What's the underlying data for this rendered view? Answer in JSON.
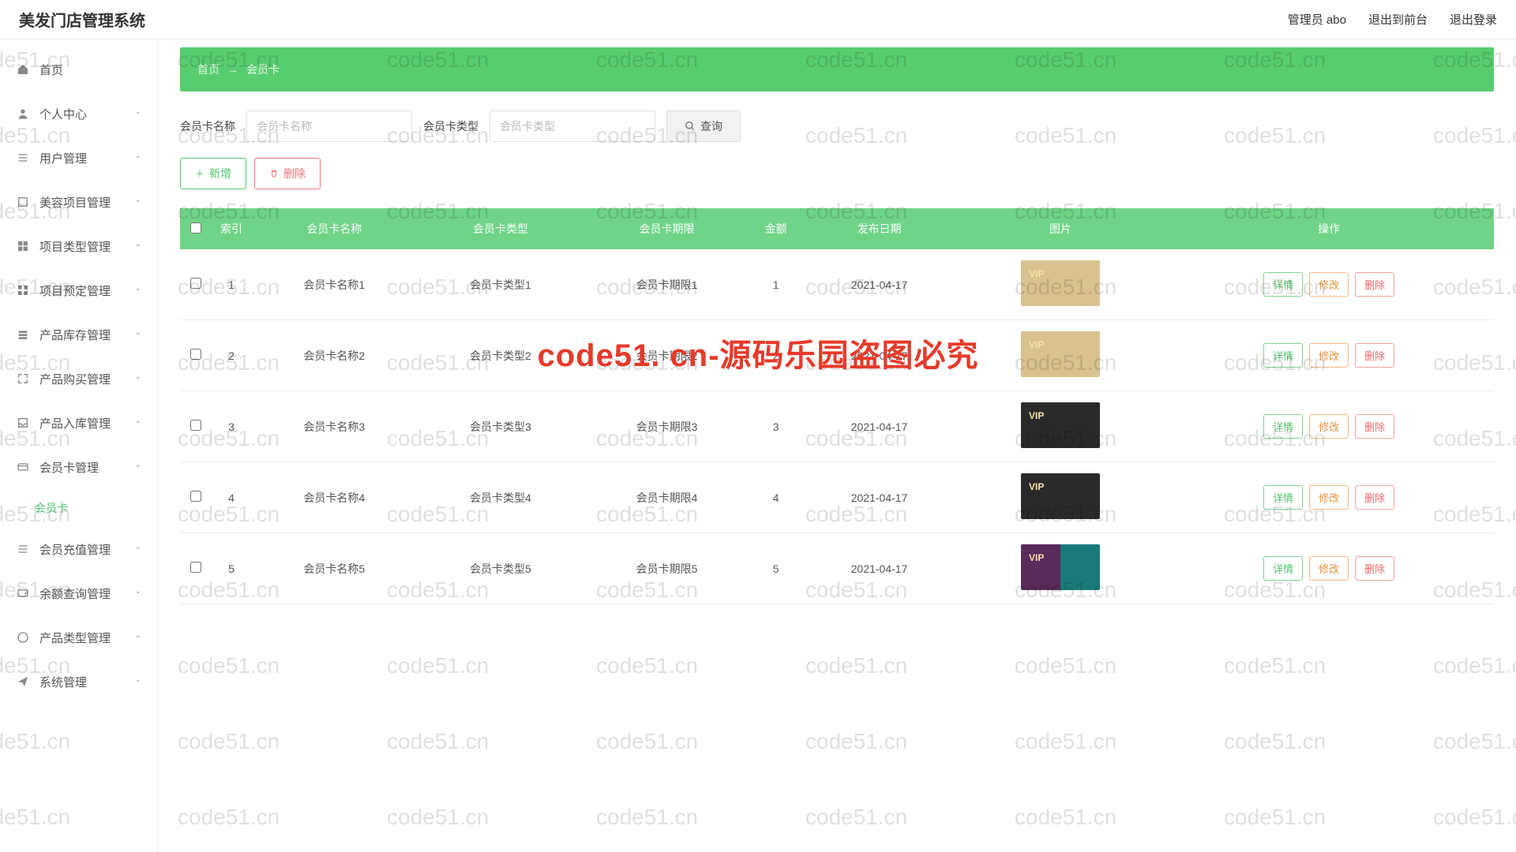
{
  "header": {
    "title": "美发门店管理系统",
    "admin_label": "管理员 abo",
    "to_front": "退出到前台",
    "logout": "退出登录"
  },
  "sidebar": {
    "items": [
      {
        "icon": "home",
        "label": "首页",
        "expandable": false
      },
      {
        "icon": "user",
        "label": "个人中心",
        "expandable": true
      },
      {
        "icon": "list",
        "label": "用户管理",
        "expandable": true
      },
      {
        "icon": "box",
        "label": "美容项目管理",
        "expandable": true
      },
      {
        "icon": "grid",
        "label": "项目类型管理",
        "expandable": true
      },
      {
        "icon": "grid4",
        "label": "项目预定管理",
        "expandable": true
      },
      {
        "icon": "stack",
        "label": "产品库存管理",
        "expandable": true
      },
      {
        "icon": "expand",
        "label": "产品购买管理",
        "expandable": true
      },
      {
        "icon": "inbox",
        "label": "产品入库管理",
        "expandable": true
      },
      {
        "icon": "card",
        "label": "会员卡管理",
        "expandable": true,
        "open": true,
        "children": [
          {
            "label": "会员卡"
          }
        ]
      },
      {
        "icon": "list",
        "label": "会员充值管理",
        "expandable": true
      },
      {
        "icon": "wallet",
        "label": "余额查询管理",
        "expandable": true
      },
      {
        "icon": "circle",
        "label": "产品类型管理",
        "expandable": true
      },
      {
        "icon": "send",
        "label": "系统管理",
        "expandable": true
      }
    ]
  },
  "breadcrumb": {
    "home": "首页",
    "sep": "→",
    "current": "会员卡"
  },
  "filters": {
    "name_label": "会员卡名称",
    "name_placeholder": "会员卡名称",
    "type_label": "会员卡类型",
    "type_placeholder": "会员卡类型",
    "query": "查询"
  },
  "toolbar": {
    "add": "新增",
    "delete": "删除"
  },
  "table": {
    "columns": [
      "",
      "索引",
      "会员卡名称",
      "会员卡类型",
      "会员卡期限",
      "金额",
      "发布日期",
      "图片",
      "操作"
    ],
    "actions": {
      "detail": "详情",
      "edit": "修改",
      "delete": "删除"
    },
    "rows": [
      {
        "idx": "1",
        "name": "会员卡名称1",
        "type": "会员卡类型1",
        "term": "会员卡期限1",
        "amount": "1",
        "date": "2021-04-17",
        "img": "gold"
      },
      {
        "idx": "2",
        "name": "会员卡名称2",
        "type": "会员卡类型2",
        "term": "会员卡期限2",
        "amount": "2",
        "date": "2021-04-17",
        "img": "gold"
      },
      {
        "idx": "3",
        "name": "会员卡名称3",
        "type": "会员卡类型3",
        "term": "会员卡期限3",
        "amount": "3",
        "date": "2021-04-17",
        "img": "dark"
      },
      {
        "idx": "4",
        "name": "会员卡名称4",
        "type": "会员卡类型4",
        "term": "会员卡期限4",
        "amount": "4",
        "date": "2021-04-17",
        "img": "dark"
      },
      {
        "idx": "5",
        "name": "会员卡名称5",
        "type": "会员卡类型5",
        "term": "会员卡期限5",
        "amount": "5",
        "date": "2021-04-17",
        "img": "multi"
      }
    ]
  },
  "watermark": {
    "text": "code51.cn",
    "big": "code51. cn-源码乐园盗图必究"
  }
}
